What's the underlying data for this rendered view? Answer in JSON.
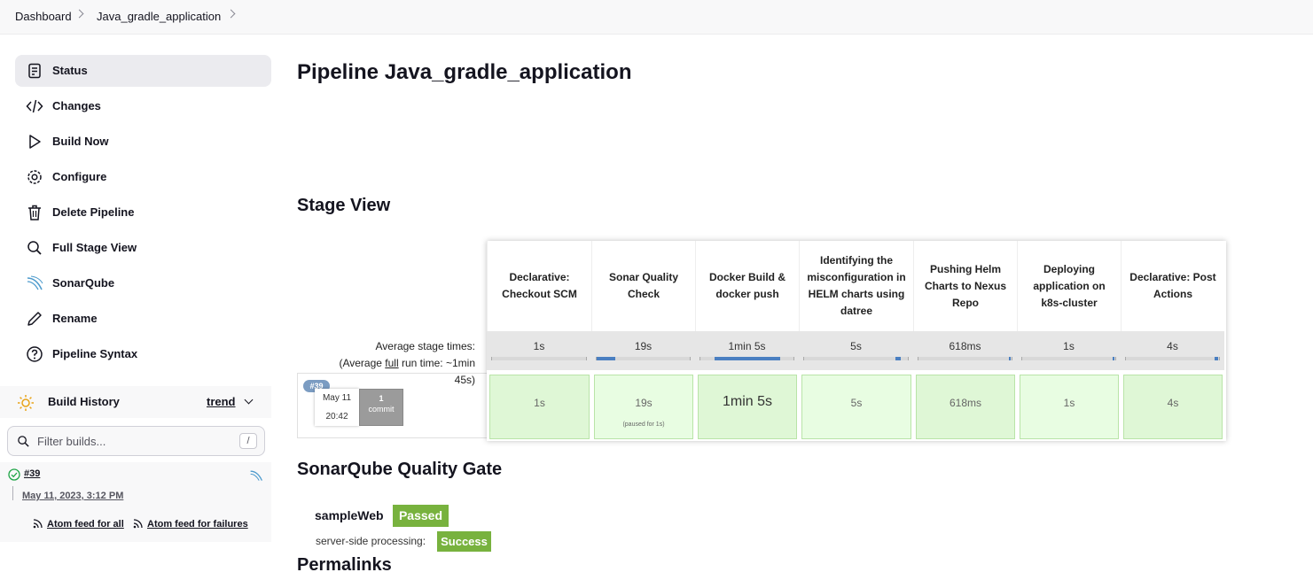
{
  "breadcrumb": {
    "dashboard": "Dashboard",
    "job": "Java_gradle_application"
  },
  "sidebar": {
    "items": [
      {
        "label": "Status",
        "icon": "status-icon"
      },
      {
        "label": "Changes",
        "icon": "code-icon"
      },
      {
        "label": "Build Now",
        "icon": "play-icon"
      },
      {
        "label": "Configure",
        "icon": "gear-icon"
      },
      {
        "label": "Delete Pipeline",
        "icon": "trash-icon"
      },
      {
        "label": "Full Stage View",
        "icon": "search-icon"
      },
      {
        "label": "SonarQube",
        "icon": "sonarqube-icon"
      },
      {
        "label": "Rename",
        "icon": "pencil-icon"
      },
      {
        "label": "Pipeline Syntax",
        "icon": "help-icon"
      }
    ]
  },
  "build_history": {
    "title": "Build History",
    "trend": "trend",
    "filter_placeholder": "Filter builds...",
    "shortcut": "/",
    "build": {
      "number": "#39",
      "date": "May 11, 2023, 3:12 PM"
    },
    "feed_all": "Atom feed for all",
    "feed_failures": "Atom feed for failures"
  },
  "main": {
    "title": "Pipeline Java_gradle_application",
    "stage_view_title": "Stage View",
    "avg_label_1": "Average stage times:",
    "avg_label_2": "(Average ",
    "avg_label_full": "full",
    "avg_label_3": " run time: ~1min",
    "avg_label_4": "45s)",
    "stages": [
      {
        "name": "Declarative: Checkout SCM",
        "avg": "1s",
        "run": "1s",
        "avg_fraction": 0.0
      },
      {
        "name": "Sonar Quality Check",
        "avg": "19s",
        "run": "19s",
        "run_note": "(paused for 1s)",
        "avg_fraction": 0.2
      },
      {
        "name": "Docker Build & docker push",
        "avg": "1min 5s",
        "run": "1min 5s",
        "avg_fraction": 0.7
      },
      {
        "name": "Identifying the misconfiguration in HELM charts using datree",
        "avg": "5s",
        "run": "5s",
        "avg_fraction": 0.05
      },
      {
        "name": "Pushing Helm Charts to Nexus Repo",
        "avg": "618ms",
        "run": "618ms",
        "avg_fraction": 0.01
      },
      {
        "name": "Deploying application on k8s-cluster",
        "avg": "1s",
        "run": "1s",
        "avg_fraction": 0.01
      },
      {
        "name": "Declarative: Post Actions",
        "avg": "4s",
        "run": "4s",
        "avg_fraction": 0.04
      }
    ],
    "run": {
      "badge": "#39",
      "date": "May 11",
      "time": "20:42",
      "commit_count": "1",
      "commit_label": "commit"
    },
    "sonar_title": "SonarQube Quality Gate",
    "sonar_project": "sampleWeb",
    "sonar_status": "Passed",
    "sonar_processing_label": "server-side processing:",
    "sonar_processing_status": "Success",
    "permalinks_title": "Permalinks"
  },
  "colors": {
    "success_green": "#78b23e",
    "stage_cell": "#dff7d6",
    "bar_blue": "#4a7fc1"
  }
}
